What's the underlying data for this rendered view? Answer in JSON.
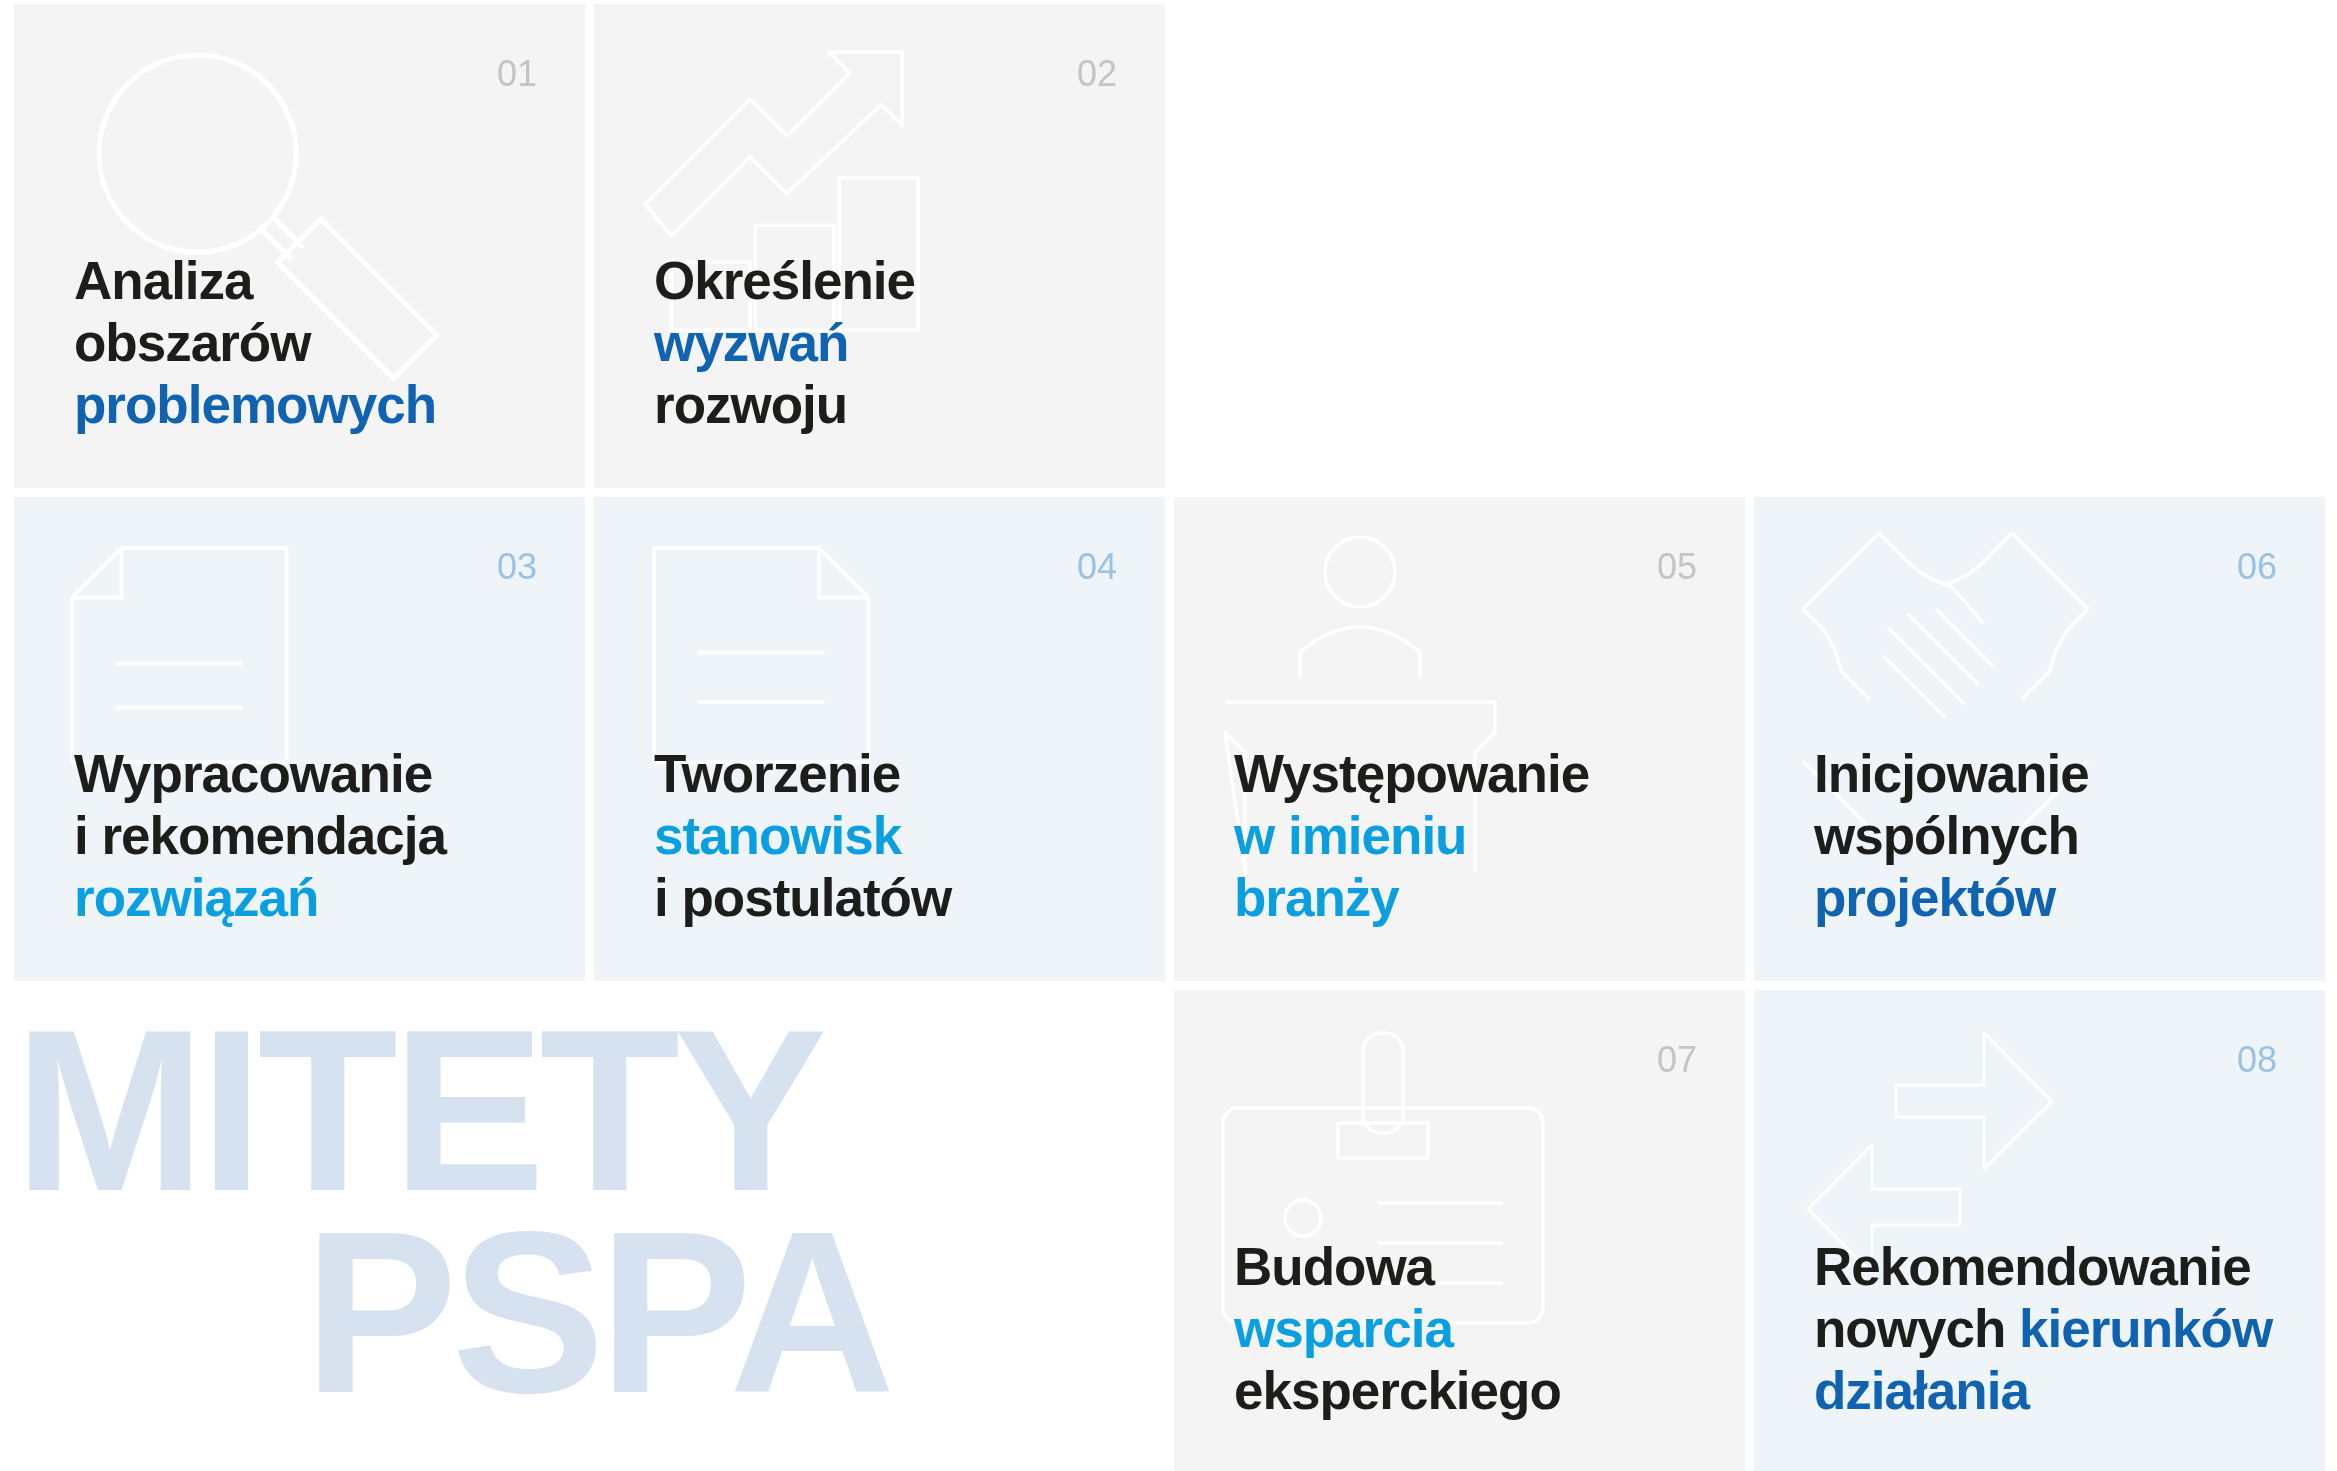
{
  "background_text": [
    "MITETY",
    "PSPA"
  ],
  "tiles": [
    {
      "number": "01",
      "color": "#f4f4f4",
      "lines": [
        [
          {
            "text": "Analiza"
          }
        ],
        [
          {
            "text": "obszarów"
          }
        ],
        [
          {
            "text": "problemowych",
            "color": "#0f63b0"
          }
        ]
      ]
    },
    {
      "number": "02",
      "color": "#f4f4f4",
      "lines": [
        [
          {
            "text": "Określenie"
          }
        ],
        [
          {
            "text": "wyzwań",
            "color": "#0f63b0"
          }
        ],
        [
          {
            "text": "rozwoju"
          }
        ]
      ]
    },
    {
      "number": "03",
      "color": "#eff4f9",
      "lines": [
        [
          {
            "text": "Wypracowanie"
          }
        ],
        [
          {
            "text": "i rekomendacja"
          }
        ],
        [
          {
            "text": "rozwiązań",
            "color": "#0a9fe0"
          }
        ]
      ]
    },
    {
      "number": "04",
      "color": "#eff4f9",
      "lines": [
        [
          {
            "text": "Tworzenie"
          }
        ],
        [
          {
            "text": "stanowisk",
            "color": "#0a9fe0"
          }
        ],
        [
          {
            "text": "i postulatów"
          }
        ]
      ]
    },
    {
      "number": "05",
      "color": "#f4f4f4",
      "lines": [
        [
          {
            "text": "Występowanie"
          }
        ],
        [
          {
            "text": "w imieniu",
            "color": "#0a9fe0"
          }
        ],
        [
          {
            "text": "branży",
            "color": "#0a9fe0"
          }
        ]
      ]
    },
    {
      "number": "06",
      "color": "#eff4f9",
      "lines": [
        [
          {
            "text": "Inicjowanie"
          }
        ],
        [
          {
            "text": "wspólnych"
          }
        ],
        [
          {
            "text": "projektów",
            "color": "#0f63b0"
          }
        ]
      ]
    },
    {
      "number": "07",
      "color": "#f4f4f4",
      "lines": [
        [
          {
            "text": "Budowa"
          }
        ],
        [
          {
            "text": "wsparcia",
            "color": "#0a9fe0"
          }
        ],
        [
          {
            "text": "eksperckiego"
          }
        ]
      ]
    },
    {
      "number": "08",
      "color": "#eff4f9",
      "lines": [
        [
          {
            "text": "Rekomendowanie"
          }
        ],
        [
          {
            "text": "nowych"
          },
          {
            "text": "kierunków",
            "color": "#0f63b0"
          }
        ],
        [
          {
            "text": "działania",
            "color": "#0f63b0"
          }
        ]
      ]
    }
  ]
}
